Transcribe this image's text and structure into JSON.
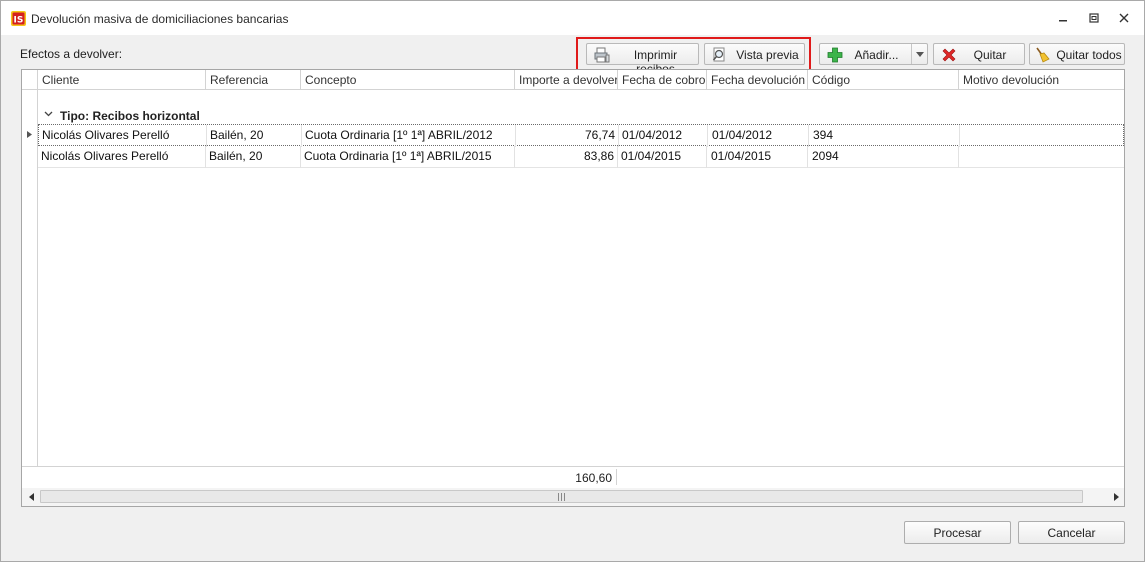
{
  "window": {
    "title": "Devolución masiva de domiciliaciones bancarias"
  },
  "form": {
    "efectos_label": "Efectos a devolver:"
  },
  "toolbar": {
    "print_label": "Imprimir recibos",
    "preview_label": "Vista previa",
    "add_label": "Añadir...",
    "remove_label": "Quitar",
    "remove_all_label": "Quitar todos",
    "highlight_color": "#e01a1a"
  },
  "grid": {
    "columns": [
      "Cliente",
      "Referencia",
      "Concepto",
      "Importe a devolver",
      "Fecha de cobro",
      "Fecha devolución",
      "Código",
      "Motivo devolución"
    ],
    "group_label": "Tipo: Recibos horizontal",
    "rows": [
      {
        "cliente": "Nicolás Olivares Perelló",
        "referencia": "Bailén, 20",
        "concepto": "Cuota Ordinaria [1º 1ª] ABRIL/2012",
        "importe": "76,74",
        "fecha_cobro": "01/04/2012",
        "fecha_devolucion": "01/04/2012",
        "codigo": "394",
        "motivo": ""
      },
      {
        "cliente": "Nicolás Olivares Perelló",
        "referencia": "Bailén, 20",
        "concepto": "Cuota Ordinaria [1º 1ª] ABRIL/2015",
        "importe": "83,86",
        "fecha_cobro": "01/04/2015",
        "fecha_devolucion": "01/04/2015",
        "codigo": "2094",
        "motivo": ""
      }
    ],
    "total_importe": "160,60"
  },
  "actions": {
    "process_label": "Procesar",
    "cancel_label": "Cancelar"
  }
}
